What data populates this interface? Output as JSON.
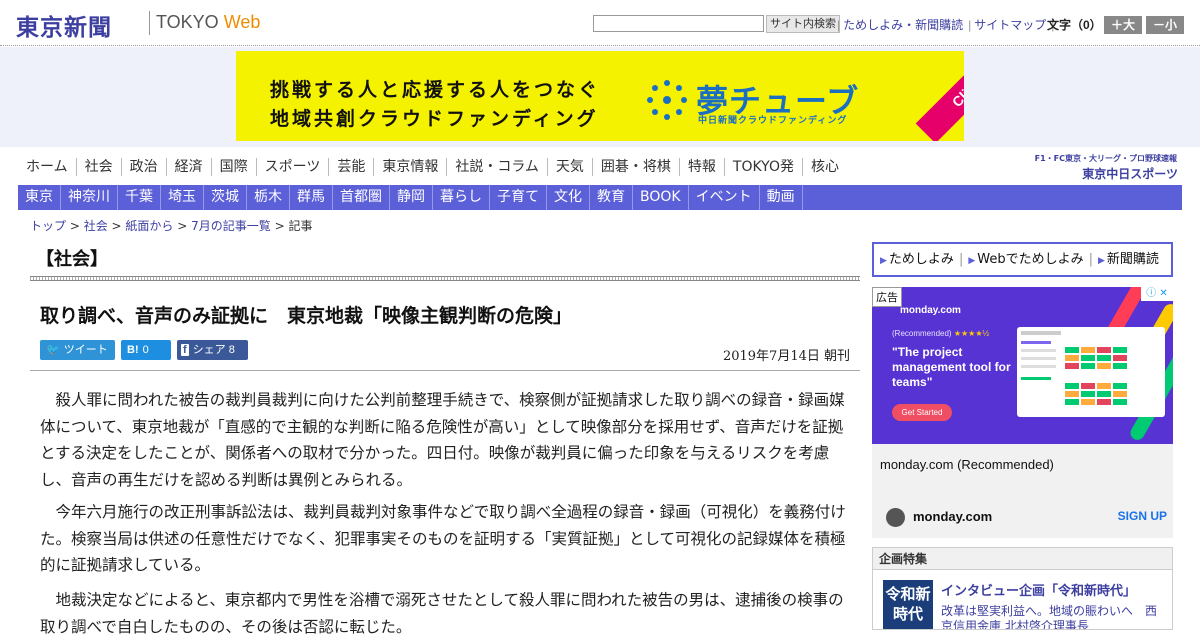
{
  "header": {
    "logo_ja": "東京新聞",
    "logo_en_prefix": "TOKYO ",
    "logo_en_suffix": "Web",
    "search_placeholder": "",
    "search_button": "サイト内検索",
    "links": [
      "ためしよみ・新聞購読",
      "サイトマップ"
    ],
    "font_size_label": "文字（0）",
    "font_larger": "＋大",
    "font_smaller": "－小"
  },
  "banner": {
    "line1": "挑戦する人と応援する人をつなぐ",
    "line2": "地域共創クラウドファンディング",
    "brand": "夢チューブ",
    "sub": "中日新聞クラウドファンディング",
    "click": "Click!"
  },
  "nav_main": [
    "ホーム",
    "社会",
    "政治",
    "経済",
    "国際",
    "スポーツ",
    "芸能",
    "東京情報",
    "社説・コラム",
    "天気",
    "囲碁・将棋",
    "特報",
    "TOKYO発",
    "核心"
  ],
  "chunichi": {
    "line1": "F1・FC東京・大リーグ・プロ野球速報",
    "logo": "東京中日スポーツ"
  },
  "nav_sub": [
    "東京",
    "神奈川",
    "千葉",
    "埼玉",
    "茨城",
    "栃木",
    "群馬",
    "首都圏",
    "静岡",
    "暮らし",
    "子育て",
    "文化",
    "教育",
    "BOOK",
    "イベント",
    "動画"
  ],
  "breadcrumb": [
    "トップ",
    "社会",
    "紙面から",
    "7月の記事一覧",
    "記事"
  ],
  "article": {
    "section": "【社会】",
    "headline": "取り調べ、音声のみ証拠に　東京地裁「映像主観判断の危険」",
    "date": "2019年7月14日 朝刊",
    "share": {
      "tweet": "ツイート",
      "hatena_count": "0",
      "facebook_label": "シェア",
      "facebook_count": "8"
    },
    "paragraphs": [
      "殺人罪に問われた被告の裁判員裁判に向けた公判前整理手続きで、検察側が証拠請求した取り調べの録音・録画媒体について、東京地裁が「直感的で主観的な判断に陥る危険性が高い」として映像部分を採用せず、音声だけを証拠とする決定をしたことが、関係者への取材で分かった。四日付。映像が裁判員に偏った印象を与えるリスクを考慮し、音声の再生だけを認める判断は異例とみられる。",
      "今年六月施行の改正刑事訴訟法は、裁判員裁判対象事件などで取り調べ全過程の録音・録画（可視化）を義務付けた。検察当局は供述の任意性だけでなく、犯罪事実そのものを証明する「実質証拠」として可視化の記録媒体を積極的に証拠請求している。",
      "地裁決定などによると、東京都内で男性を浴槽で溺死させたとして殺人罪に問われた被告の男は、逮捕後の検事の取り調べで自白したものの、その後は否認に転じた。"
    ]
  },
  "sidebar": {
    "subscribe": [
      "ためしよみ",
      "Webでためしよみ",
      "新聞購読"
    ],
    "ad": {
      "tag": "広告",
      "close": "ⓘ ✕",
      "brand_small": "monday.com",
      "recommended": "(Recommended)",
      "stars": "★★★★½",
      "quote": "\"The project management tool for teams\"",
      "cta": "Get Started",
      "caption": "monday.com (Recommended)",
      "domain": "monday.com",
      "signup": "SIGN UP"
    },
    "feature": {
      "heading": "企画特集",
      "img_text": "令和新時代",
      "title": "インタビュー企画「令和新時代」",
      "desc": "改革は堅実利益へ。地域の賑わいへ　西京信用金庫 北村啓介理事長"
    }
  }
}
